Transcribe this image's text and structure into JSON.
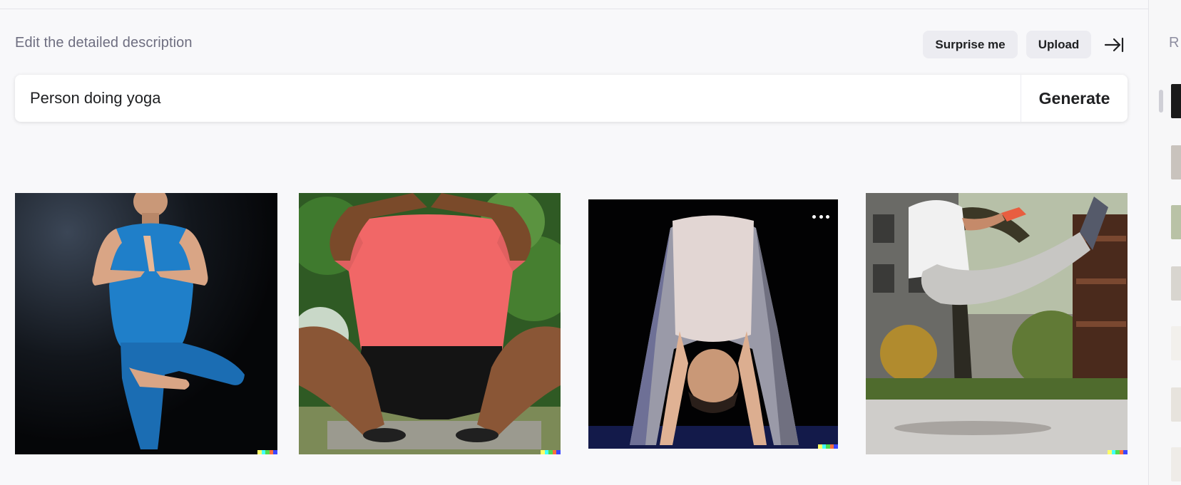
{
  "header": {
    "subtitle": "Edit the detailed description",
    "surprise_label": "Surprise me",
    "upload_label": "Upload",
    "collapse_icon": "arrow-right-to-line-icon"
  },
  "prompt": {
    "value": "Person doing yoga",
    "generate_label": "Generate"
  },
  "results": [
    {
      "subject": "man in blue tank top doing tree pose"
    },
    {
      "subject": "person in red t-shirt sitting cross-legged outdoors"
    },
    {
      "subject": "person in forward bend on black background",
      "menu_icon": "more-dots-icon"
    },
    {
      "subject": "person doing flying kick outdoors"
    }
  ],
  "history": {
    "title_fragment": "R",
    "thumbnail_count": 8
  },
  "colors": {
    "background": "#f8f8fa",
    "chip": "#ececf1",
    "text": "#202123",
    "muted": "#6e6e80"
  }
}
